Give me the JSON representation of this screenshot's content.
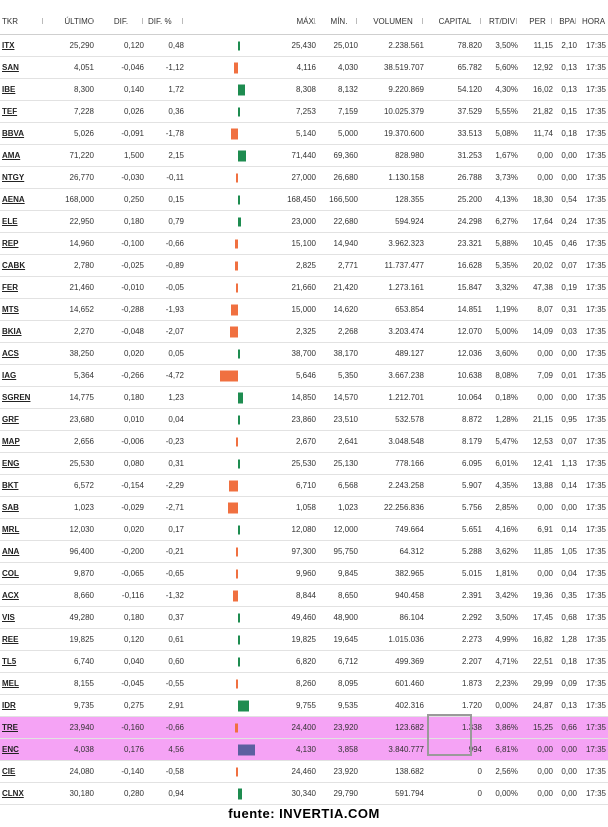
{
  "headers": [
    "TKR",
    "ÚLTIMO",
    "DIF.",
    "DIF. %",
    "",
    "MÁX.",
    "MÍN.",
    "VOLUMEN",
    "CAPITAL",
    "RT/DIV",
    "PER",
    "BPA",
    "HORA"
  ],
  "colors": {
    "up": "#1e8c50",
    "down": "#f07040",
    "highlight": "#f5a3f5",
    "box": "#9a9a9a"
  },
  "rows": [
    {
      "tkr": "ITX",
      "ultimo": "25,290",
      "dif": "0,120",
      "difp": "0,48",
      "pct": 0.48,
      "max": "25,430",
      "min": "25,010",
      "vol": "2.238.561",
      "cap": "78.820",
      "rtdiv": "3,50%",
      "per": "11,15",
      "bpa": "2,10",
      "hora": "17:35"
    },
    {
      "tkr": "SAN",
      "ultimo": "4,051",
      "dif": "-0,046",
      "difp": "-1,12",
      "pct": -1.12,
      "max": "4,116",
      "min": "4,030",
      "vol": "38.519.707",
      "cap": "65.782",
      "rtdiv": "5,60%",
      "per": "12,92",
      "bpa": "0,13",
      "hora": "17:35"
    },
    {
      "tkr": "IBE",
      "ultimo": "8,300",
      "dif": "0,140",
      "difp": "1,72",
      "pct": 1.72,
      "max": "8,308",
      "min": "8,132",
      "vol": "9.220.869",
      "cap": "54.120",
      "rtdiv": "4,30%",
      "per": "16,02",
      "bpa": "0,13",
      "hora": "17:35"
    },
    {
      "tkr": "TEF",
      "ultimo": "7,228",
      "dif": "0,026",
      "difp": "0,36",
      "pct": 0.36,
      "max": "7,253",
      "min": "7,159",
      "vol": "10.025.379",
      "cap": "37.529",
      "rtdiv": "5,55%",
      "per": "21,82",
      "bpa": "0,15",
      "hora": "17:35"
    },
    {
      "tkr": "BBVA",
      "ultimo": "5,026",
      "dif": "-0,091",
      "difp": "-1,78",
      "pct": -1.78,
      "max": "5,140",
      "min": "5,000",
      "vol": "19.370.600",
      "cap": "33.513",
      "rtdiv": "5,08%",
      "per": "11,74",
      "bpa": "0,18",
      "hora": "17:35"
    },
    {
      "tkr": "AMA",
      "ultimo": "71,220",
      "dif": "1,500",
      "difp": "2,15",
      "pct": 2.15,
      "max": "71,440",
      "min": "69,360",
      "vol": "828.980",
      "cap": "31.253",
      "rtdiv": "1,67%",
      "per": "0,00",
      "bpa": "0,00",
      "hora": "17:35"
    },
    {
      "tkr": "NTGY",
      "ultimo": "26,770",
      "dif": "-0,030",
      "difp": "-0,11",
      "pct": -0.11,
      "max": "27,000",
      "min": "26,680",
      "vol": "1.130.158",
      "cap": "26.788",
      "rtdiv": "3,73%",
      "per": "0,00",
      "bpa": "0,00",
      "hora": "17:35"
    },
    {
      "tkr": "AENA",
      "ultimo": "168,000",
      "dif": "0,250",
      "difp": "0,15",
      "pct": 0.15,
      "max": "168,450",
      "min": "166,500",
      "vol": "128.355",
      "cap": "25.200",
      "rtdiv": "4,13%",
      "per": "18,30",
      "bpa": "0,54",
      "hora": "17:35"
    },
    {
      "tkr": "ELE",
      "ultimo": "22,950",
      "dif": "0,180",
      "difp": "0,79",
      "pct": 0.79,
      "max": "23,000",
      "min": "22,680",
      "vol": "594.924",
      "cap": "24.298",
      "rtdiv": "6,27%",
      "per": "17,64",
      "bpa": "0,24",
      "hora": "17:35"
    },
    {
      "tkr": "REP",
      "ultimo": "14,960",
      "dif": "-0,100",
      "difp": "-0,66",
      "pct": -0.66,
      "max": "15,100",
      "min": "14,940",
      "vol": "3.962.323",
      "cap": "23.321",
      "rtdiv": "5,88%",
      "per": "10,45",
      "bpa": "0,46",
      "hora": "17:35"
    },
    {
      "tkr": "CABK",
      "ultimo": "2,780",
      "dif": "-0,025",
      "difp": "-0,89",
      "pct": -0.89,
      "max": "2,825",
      "min": "2,771",
      "vol": "11.737.477",
      "cap": "16.628",
      "rtdiv": "5,35%",
      "per": "20,02",
      "bpa": "0,07",
      "hora": "17:35"
    },
    {
      "tkr": "FER",
      "ultimo": "21,460",
      "dif": "-0,010",
      "difp": "-0,05",
      "pct": -0.05,
      "max": "21,660",
      "min": "21,420",
      "vol": "1.273.161",
      "cap": "15.847",
      "rtdiv": "3,32%",
      "per": "47,38",
      "bpa": "0,19",
      "hora": "17:35"
    },
    {
      "tkr": "MTS",
      "ultimo": "14,652",
      "dif": "-0,288",
      "difp": "-1,93",
      "pct": -1.93,
      "max": "15,000",
      "min": "14,620",
      "vol": "653.854",
      "cap": "14.851",
      "rtdiv": "1,19%",
      "per": "8,07",
      "bpa": "0,31",
      "hora": "17:35"
    },
    {
      "tkr": "BKIA",
      "ultimo": "2,270",
      "dif": "-0,048",
      "difp": "-2,07",
      "pct": -2.07,
      "max": "2,325",
      "min": "2,268",
      "vol": "3.203.474",
      "cap": "12.070",
      "rtdiv": "5,00%",
      "per": "14,09",
      "bpa": "0,03",
      "hora": "17:35"
    },
    {
      "tkr": "ACS",
      "ultimo": "38,250",
      "dif": "0,020",
      "difp": "0,05",
      "pct": 0.05,
      "max": "38,700",
      "min": "38,170",
      "vol": "489.127",
      "cap": "12.036",
      "rtdiv": "3,60%",
      "per": "0,00",
      "bpa": "0,00",
      "hora": "17:35"
    },
    {
      "tkr": "IAG",
      "ultimo": "5,364",
      "dif": "-0,266",
      "difp": "-4,72",
      "pct": -4.72,
      "max": "5,646",
      "min": "5,350",
      "vol": "3.667.238",
      "cap": "10.638",
      "rtdiv": "8,08%",
      "per": "7,09",
      "bpa": "0,01",
      "hora": "17:35"
    },
    {
      "tkr": "SGREN",
      "ultimo": "14,775",
      "dif": "0,180",
      "difp": "1,23",
      "pct": 1.23,
      "max": "14,850",
      "min": "14,570",
      "vol": "1.212.701",
      "cap": "10.064",
      "rtdiv": "0,18%",
      "per": "0,00",
      "bpa": "0,00",
      "hora": "17:35"
    },
    {
      "tkr": "GRF",
      "ultimo": "23,680",
      "dif": "0,010",
      "difp": "0,04",
      "pct": 0.04,
      "max": "23,860",
      "min": "23,510",
      "vol": "532.578",
      "cap": "8.872",
      "rtdiv": "1,28%",
      "per": "21,15",
      "bpa": "0,95",
      "hora": "17:35"
    },
    {
      "tkr": "MAP",
      "ultimo": "2,656",
      "dif": "-0,006",
      "difp": "-0,23",
      "pct": -0.23,
      "max": "2,670",
      "min": "2,641",
      "vol": "3.048.548",
      "cap": "8.179",
      "rtdiv": "5,47%",
      "per": "12,53",
      "bpa": "0,07",
      "hora": "17:35"
    },
    {
      "tkr": "ENG",
      "ultimo": "25,530",
      "dif": "0,080",
      "difp": "0,31",
      "pct": 0.31,
      "max": "25,530",
      "min": "25,130",
      "vol": "778.166",
      "cap": "6.095",
      "rtdiv": "6,01%",
      "per": "12,41",
      "bpa": "1,13",
      "hora": "17:35"
    },
    {
      "tkr": "BKT",
      "ultimo": "6,572",
      "dif": "-0,154",
      "difp": "-2,29",
      "pct": -2.29,
      "max": "6,710",
      "min": "6,568",
      "vol": "2.243.258",
      "cap": "5.907",
      "rtdiv": "4,35%",
      "per": "13,88",
      "bpa": "0,14",
      "hora": "17:35"
    },
    {
      "tkr": "SAB",
      "ultimo": "1,023",
      "dif": "-0,029",
      "difp": "-2,71",
      "pct": -2.71,
      "max": "1,058",
      "min": "1,023",
      "vol": "22.256.836",
      "cap": "5.756",
      "rtdiv": "2,85%",
      "per": "0,00",
      "bpa": "0,00",
      "hora": "17:35"
    },
    {
      "tkr": "MRL",
      "ultimo": "12,030",
      "dif": "0,020",
      "difp": "0,17",
      "pct": 0.17,
      "max": "12,080",
      "min": "12,000",
      "vol": "749.664",
      "cap": "5.651",
      "rtdiv": "4,16%",
      "per": "6,91",
      "bpa": "0,14",
      "hora": "17:35"
    },
    {
      "tkr": "ANA",
      "ultimo": "96,400",
      "dif": "-0,200",
      "difp": "-0,21",
      "pct": -0.21,
      "max": "97,300",
      "min": "95,750",
      "vol": "64.312",
      "cap": "5.288",
      "rtdiv": "3,62%",
      "per": "11,85",
      "bpa": "1,05",
      "hora": "17:35"
    },
    {
      "tkr": "COL",
      "ultimo": "9,870",
      "dif": "-0,065",
      "difp": "-0,65",
      "pct": -0.65,
      "max": "9,960",
      "min": "9,845",
      "vol": "382.965",
      "cap": "5.015",
      "rtdiv": "1,81%",
      "per": "0,00",
      "bpa": "0,04",
      "hora": "17:35"
    },
    {
      "tkr": "ACX",
      "ultimo": "8,660",
      "dif": "-0,116",
      "difp": "-1,32",
      "pct": -1.32,
      "max": "8,844",
      "min": "8,650",
      "vol": "940.458",
      "cap": "2.391",
      "rtdiv": "3,42%",
      "per": "19,36",
      "bpa": "0,35",
      "hora": "17:35"
    },
    {
      "tkr": "VIS",
      "ultimo": "49,280",
      "dif": "0,180",
      "difp": "0,37",
      "pct": 0.37,
      "max": "49,460",
      "min": "48,900",
      "vol": "86.104",
      "cap": "2.292",
      "rtdiv": "3,50%",
      "per": "17,45",
      "bpa": "0,68",
      "hora": "17:35"
    },
    {
      "tkr": "REE",
      "ultimo": "19,825",
      "dif": "0,120",
      "difp": "0,61",
      "pct": 0.61,
      "max": "19,825",
      "min": "19,645",
      "vol": "1.015.036",
      "cap": "2.273",
      "rtdiv": "4,99%",
      "per": "16,82",
      "bpa": "1,28",
      "hora": "17:35"
    },
    {
      "tkr": "TL5",
      "ultimo": "6,740",
      "dif": "0,040",
      "difp": "0,60",
      "pct": 0.6,
      "max": "6,820",
      "min": "6,712",
      "vol": "499.369",
      "cap": "2.207",
      "rtdiv": "4,71%",
      "per": "22,51",
      "bpa": "0,18",
      "hora": "17:35"
    },
    {
      "tkr": "MEL",
      "ultimo": "8,155",
      "dif": "-0,045",
      "difp": "-0,55",
      "pct": -0.55,
      "max": "8,260",
      "min": "8,095",
      "vol": "601.460",
      "cap": "1.873",
      "rtdiv": "2,23%",
      "per": "29,99",
      "bpa": "0,09",
      "hora": "17:35"
    },
    {
      "tkr": "IDR",
      "ultimo": "9,735",
      "dif": "0,275",
      "difp": "2,91",
      "pct": 2.91,
      "max": "9,755",
      "min": "9,535",
      "vol": "402.316",
      "cap": "1.720",
      "rtdiv": "0,00%",
      "per": "24,87",
      "bpa": "0,13",
      "hora": "17:35"
    },
    {
      "tkr": "TRE",
      "ultimo": "23,940",
      "dif": "-0,160",
      "difp": "-0,66",
      "pct": -0.66,
      "max": "24,400",
      "min": "23,920",
      "vol": "123.682",
      "cap": "1.338",
      "rtdiv": "3,86%",
      "per": "15,25",
      "bpa": "0,66",
      "hora": "17:35",
      "hl": true
    },
    {
      "tkr": "ENC",
      "ultimo": "4,038",
      "dif": "0,176",
      "difp": "4,56",
      "pct": 4.56,
      "max": "4,130",
      "min": "3,858",
      "vol": "3.840.777",
      "cap": "994",
      "rtdiv": "6,81%",
      "per": "0,00",
      "bpa": "0,00",
      "hora": "17:35",
      "hl": true,
      "barcolor": "#5b5fa0"
    },
    {
      "tkr": "CIE",
      "ultimo": "24,080",
      "dif": "-0,140",
      "difp": "-0,58",
      "pct": -0.58,
      "max": "24,460",
      "min": "23,920",
      "vol": "138.682",
      "cap": "0",
      "rtdiv": "2,56%",
      "per": "0,00",
      "bpa": "0,00",
      "hora": "17:35"
    },
    {
      "tkr": "CLNX",
      "ultimo": "30,180",
      "dif": "0,280",
      "difp": "0,94",
      "pct": 0.94,
      "max": "30,340",
      "min": "29,790",
      "vol": "591.794",
      "cap": "0",
      "rtdiv": "0,00%",
      "per": "0,00",
      "bpa": "0,00",
      "hora": "17:35"
    }
  ],
  "footer": "fuente: INVERTIA.COM"
}
